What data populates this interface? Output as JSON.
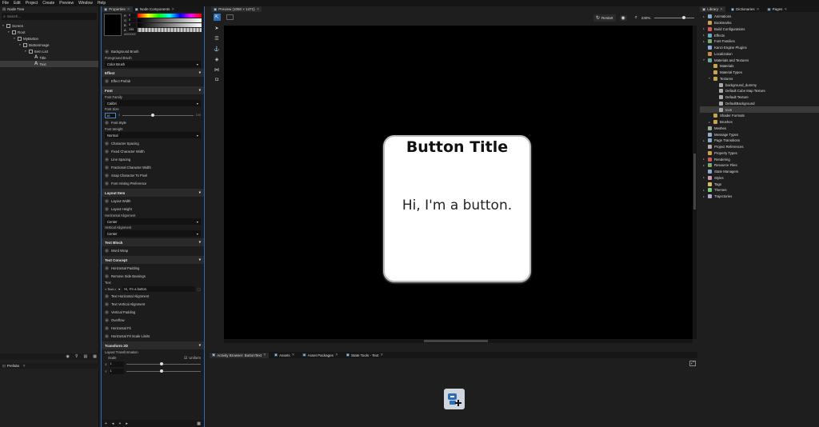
{
  "menu": [
    "File",
    "Edit",
    "Project",
    "Create",
    "Preview",
    "Window",
    "Help"
  ],
  "left": {
    "tab_title": "Node Tree",
    "search_placeholder": "Search...",
    "tree": [
      {
        "label": "Screen",
        "depth": 0,
        "icon": "screen-icon"
      },
      {
        "label": "Root",
        "depth": 1,
        "icon": "node-icon"
      },
      {
        "label": "MyButton",
        "depth": 2,
        "icon": "node-icon"
      },
      {
        "label": "ButtonImage",
        "depth": 3,
        "icon": "image-node-icon"
      },
      {
        "label": "Item List",
        "depth": 4,
        "icon": "list-icon"
      },
      {
        "label": "Title",
        "depth": 5,
        "icon": "text-block-icon"
      },
      {
        "label": "Text",
        "depth": 5,
        "icon": "text-block-icon",
        "selected": true
      }
    ],
    "prefabs_label": "Prefabs"
  },
  "props": {
    "tab_properties": "Properties",
    "tab_components": "Node Components",
    "color_labels": [
      "R",
      "G",
      "B",
      "A"
    ],
    "color_values": [
      "0",
      "0",
      "0",
      "255"
    ],
    "hex_label": "#000000",
    "background_brush": "Background Brush",
    "foreground_brush": "Foreground Brush",
    "foreground_value": "Color Brush",
    "sections": {
      "effect": "Effect",
      "font": "Font",
      "layout": "Layout Item",
      "textblock": "Text Block",
      "textconcept": "Text Concept",
      "transform": "Transform 2D"
    },
    "effect_prefab": "Effect Prefab",
    "font_family_label": "Font Family",
    "font_family_value": "Calibri",
    "font_size_label": "Font Size",
    "font_size_value": "16",
    "font_size_min": "0",
    "font_size_max": "100",
    "font_style": "Font Style",
    "font_weight_label": "Font Weight",
    "font_weight_value": "Normal",
    "font_props": [
      "Character Spacing",
      "Fixed Character Width",
      "Line Spacing",
      "Fractional Character Width",
      "Snap Character To Pixel",
      "Font Hinting Preference"
    ],
    "layout_props": [
      "Layout Width",
      "Layout Height"
    ],
    "halign_label": "Horizontal Alignment",
    "halign_value": "Center",
    "valign_label": "Vertical Alignment",
    "valign_value": "Center",
    "wordwrap": "Word Wrap",
    "tc_props1": [
      "Horizontal Padding",
      "Remove Side Bearings"
    ],
    "text_label": "Text",
    "text_type": "< Text >",
    "text_value": "Hi, I'm a button.",
    "tc_props2": [
      "Text Horizontal Alignment",
      "Text Vertical Alignment",
      "Vertical Padding",
      "Overflow",
      "Horizontal Fit",
      "Horizontal Fit Scale Limits"
    ],
    "layout_transformation": "Layout Transformation",
    "scale_label": "Scale",
    "uniform_label": "Uniform",
    "scale_x_label": "X",
    "scale_x": "1",
    "scale_y_label": "Y",
    "scale_y": "1"
  },
  "preview": {
    "tab": "Preview (1050 × 1471)",
    "restart": "Restart",
    "zoom": "230%",
    "button_title": "Button Title",
    "button_text": "Hi, I'm a button."
  },
  "bottom_tabs": [
    "Activity Browser: ButtonText",
    "Assets",
    "Asset Packages",
    "State Tools - Text"
  ],
  "right": {
    "tab_library": "Library",
    "tab_dictionaries": "Dictionaries",
    "tab_pages": "Pages",
    "items": [
      {
        "label": "Animations",
        "depth": 0,
        "arrow": "▸",
        "color": "#8ac"
      },
      {
        "label": "Bookmarks",
        "depth": 0,
        "arrow": "",
        "color": "#c9a44a"
      },
      {
        "label": "Build Configurations",
        "depth": 0,
        "arrow": "▸",
        "color": "#d55"
      },
      {
        "label": "Effects",
        "depth": 0,
        "arrow": "▸",
        "color": "#6ab"
      },
      {
        "label": "Font Families",
        "depth": 0,
        "arrow": "▸",
        "color": "#7a7"
      },
      {
        "label": "Kanzi Engine Plugins",
        "depth": 0,
        "arrow": "",
        "color": "#8ad"
      },
      {
        "label": "Localization",
        "depth": 0,
        "arrow": "",
        "color": "#c84"
      },
      {
        "label": "Materials and Textures",
        "depth": 0,
        "arrow": "▾",
        "color": "#6a9"
      },
      {
        "label": "Materials",
        "depth": 1,
        "arrow": "",
        "color": "#c9a44a"
      },
      {
        "label": "Material Types",
        "depth": 1,
        "arrow": "",
        "color": "#c9a44a"
      },
      {
        "label": "Textures",
        "depth": 1,
        "arrow": "▾",
        "color": "#c9a44a"
      },
      {
        "label": "background_dummy",
        "depth": 2,
        "arrow": "",
        "color": "#aaa"
      },
      {
        "label": "Default Cube Map Texture",
        "depth": 2,
        "arrow": "",
        "color": "#aaa"
      },
      {
        "label": "Default Texture",
        "depth": 2,
        "arrow": "",
        "color": "#aaa"
      },
      {
        "label": "DefaultBackground",
        "depth": 2,
        "arrow": "",
        "color": "#aaa"
      },
      {
        "label": "Icon",
        "depth": 2,
        "arrow": "",
        "color": "#aaa",
        "selected": true
      },
      {
        "label": "Shader Formats",
        "depth": 1,
        "arrow": "",
        "color": "#c9a44a"
      },
      {
        "label": "Brushes",
        "depth": 1,
        "arrow": "▸",
        "color": "#c9a44a"
      },
      {
        "label": "Meshes",
        "depth": 0,
        "arrow": "",
        "color": "#9a9"
      },
      {
        "label": "Message Types",
        "depth": 0,
        "arrow": "",
        "color": "#9ac"
      },
      {
        "label": "Page Transitions",
        "depth": 0,
        "arrow": "▸",
        "color": "#8ac"
      },
      {
        "label": "Project References",
        "depth": 0,
        "arrow": "",
        "color": "#aaa"
      },
      {
        "label": "Property Types",
        "depth": 0,
        "arrow": "",
        "color": "#c9a44a"
      },
      {
        "label": "Rendering",
        "depth": 0,
        "arrow": "▸",
        "color": "#c55"
      },
      {
        "label": "Resource Files",
        "depth": 0,
        "arrow": "▸",
        "color": "#7a7"
      },
      {
        "label": "State Managers",
        "depth": 0,
        "arrow": "",
        "color": "#8ac"
      },
      {
        "label": "Styles",
        "depth": 0,
        "arrow": "▸",
        "color": "#c9a"
      },
      {
        "label": "Tags",
        "depth": 0,
        "arrow": "",
        "color": "#db6"
      },
      {
        "label": "Themes",
        "depth": 0,
        "arrow": "▸",
        "color": "#7c7"
      },
      {
        "label": "Trajectories",
        "depth": 0,
        "arrow": "▸",
        "color": "#aac"
      }
    ]
  }
}
